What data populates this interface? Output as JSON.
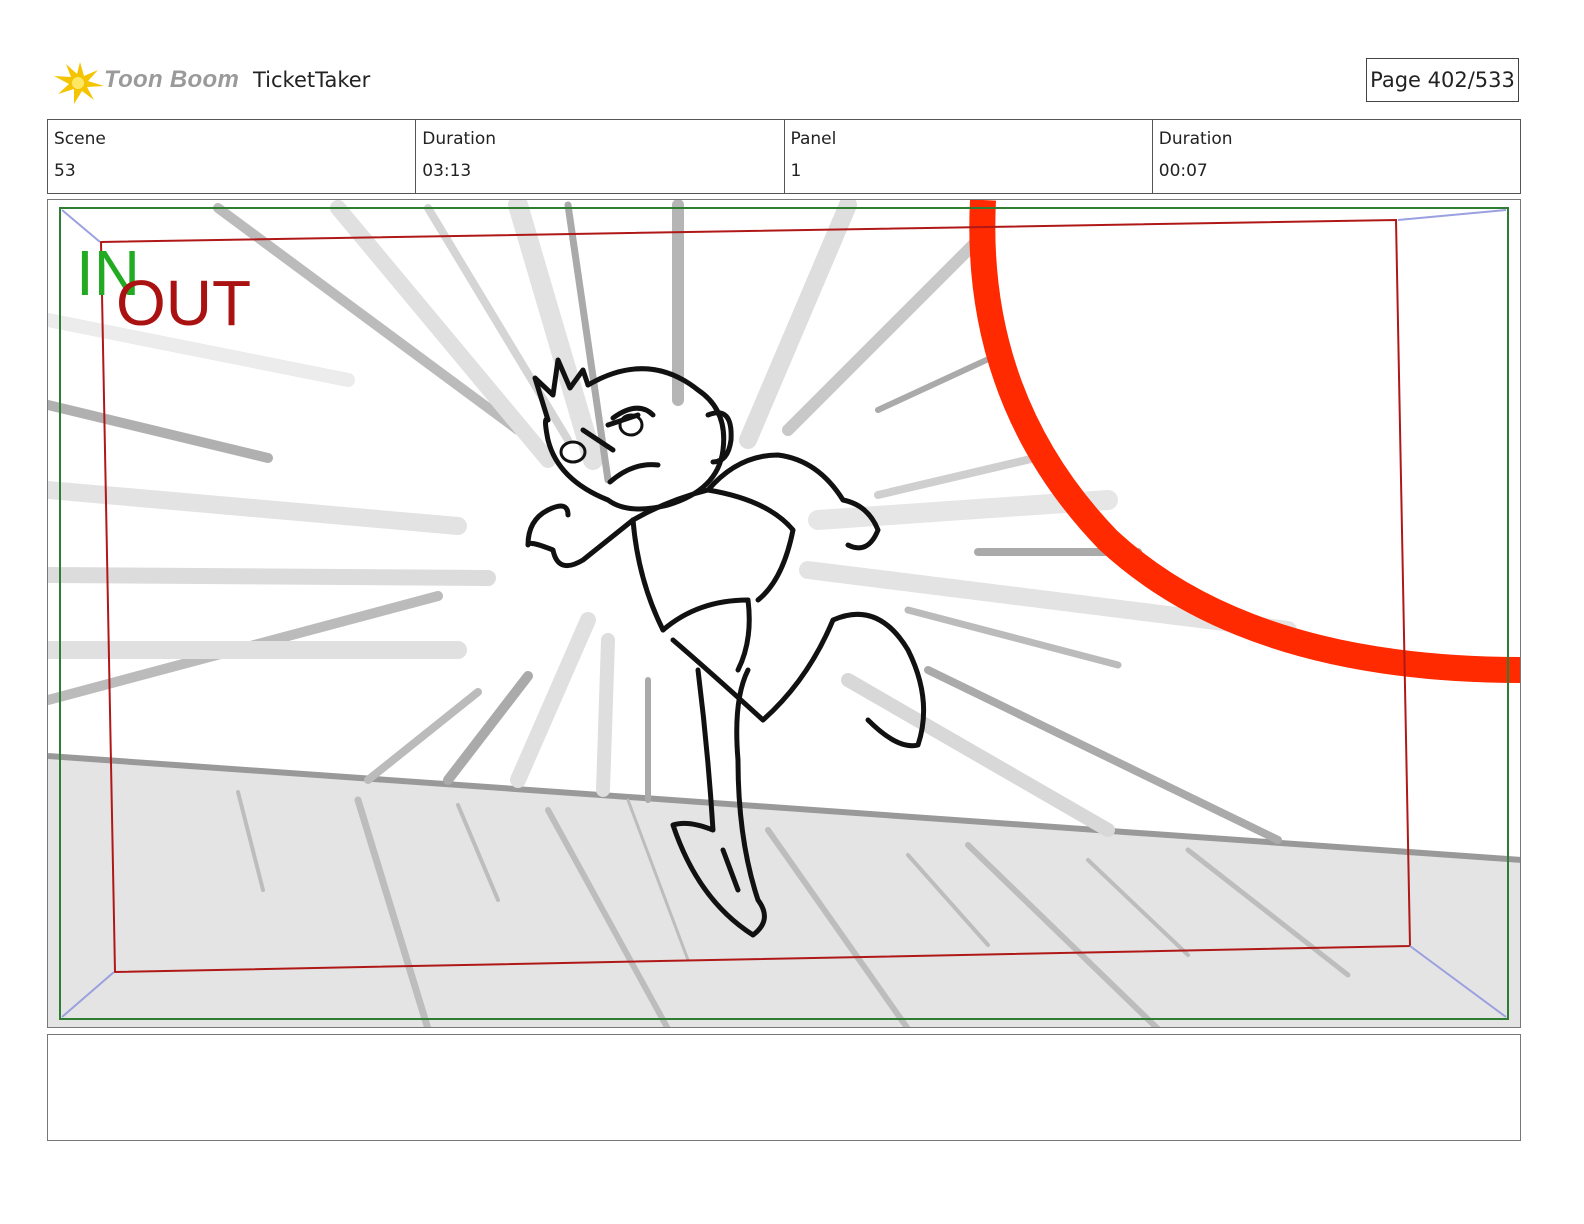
{
  "header": {
    "logo_text": "Toon Boom",
    "project_name": "TicketTaker",
    "page_label": "Page 402/533"
  },
  "info": [
    {
      "label": "Scene",
      "value": "53"
    },
    {
      "label": "Duration",
      "value": "03:13"
    },
    {
      "label": "Panel",
      "value": "1"
    },
    {
      "label": "Duration",
      "value": "00:07"
    }
  ],
  "panel": {
    "in_label": "IN",
    "out_label": "OUT",
    "in_color": "#22aa22",
    "out_color": "#aa1111",
    "safe_frame_color": "#2e7d32",
    "camera_frame_color": "#b01818",
    "arc_color": "#ff2a00"
  },
  "notes": {
    "text": ""
  }
}
